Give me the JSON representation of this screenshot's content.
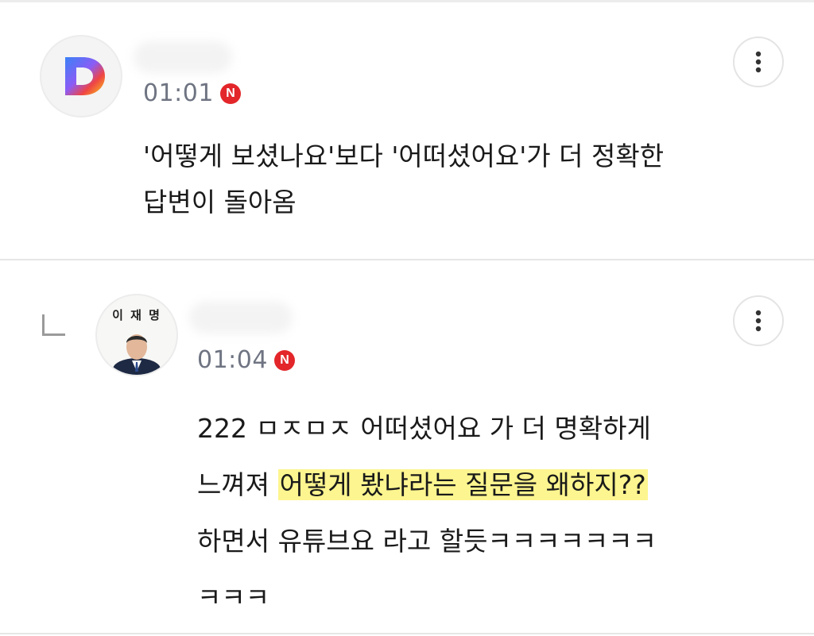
{
  "comments": [
    {
      "author_avatar": "daum-logo-avatar",
      "time": "01:01",
      "badge": "N",
      "lines": [
        "'어떻게 보셨나요'보다 '어떠셨어요'가 더 정확한",
        "답변이 돌아옴"
      ],
      "more_icon": "more-vertical-icon"
    },
    {
      "author_avatar": "politician-portrait-avatar",
      "avatar_label": "이 재 명",
      "time": "01:04",
      "badge": "N",
      "lines": {
        "l1": "222 ㅁㅈㅁㅈ 어떠셨어요 가 더 명확하게",
        "l2a": "느껴져 ",
        "l2b": "어떻게 봤냐라는 질문을 왜하지??",
        "l3": "하면서 유튜브요 라고 할듯ㅋㅋㅋㅋㅋㅋㅋ",
        "l4": "ㅋㅋㅋ"
      },
      "more_icon": "more-vertical-icon",
      "reply_icon": "reply-indent-icon"
    }
  ],
  "colors": {
    "badge": "#e3262a",
    "highlight": "#fdf58f",
    "time": "#6f7482"
  }
}
